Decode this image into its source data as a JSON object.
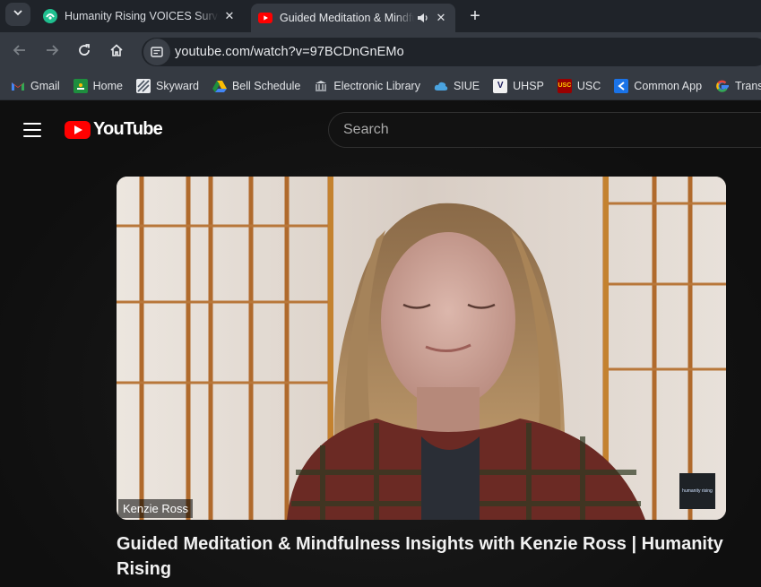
{
  "browser": {
    "tabs": [
      {
        "title": "Humanity Rising VOICES Survey",
        "favicon": "humanity-rising-icon",
        "active": false
      },
      {
        "title": "Guided Meditation & Mindfulness Insights with Kenzie Ross",
        "favicon": "youtube-icon",
        "active": true,
        "audio": true
      }
    ],
    "url": "youtube.com/watch?v=97BCDnGnEMo",
    "bookmarks": [
      {
        "label": "Gmail",
        "icon": "gmail-icon",
        "color": "#ea4335"
      },
      {
        "label": "Home",
        "icon": "classroom-icon",
        "color": "#1e8e3e"
      },
      {
        "label": "Skyward",
        "icon": "skyward-icon",
        "color": "#5f6b7a"
      },
      {
        "label": "Bell Schedule",
        "icon": "drive-icon",
        "color": "#fbbc04"
      },
      {
        "label": "Electronic Library",
        "icon": "library-icon",
        "color": "#9aa0a6"
      },
      {
        "label": "SIUE",
        "icon": "cloud-icon",
        "color": "#4aa3df"
      },
      {
        "label": "UHSP",
        "icon": "uhsp-icon",
        "color": "#2b2b6b"
      },
      {
        "label": "USC",
        "icon": "usc-icon",
        "color": "#990000"
      },
      {
        "label": "Common App",
        "icon": "common-app-icon",
        "color": "#1a73e8"
      },
      {
        "label": "Translate",
        "icon": "google-icon",
        "color": "#4285f4"
      }
    ]
  },
  "youtube": {
    "logo_text": "YouTube",
    "search_placeholder": "Search",
    "speaker_name": "Kenzie Ross",
    "watermark_text": "humanity rising",
    "video_title": "Guided Meditation & Mindfulness Insights with Kenzie Ross | Humanity Rising"
  },
  "colors": {
    "youtube_red": "#ff0000",
    "tab_bg": "#1f2329",
    "toolbar_bg": "#353a42"
  }
}
